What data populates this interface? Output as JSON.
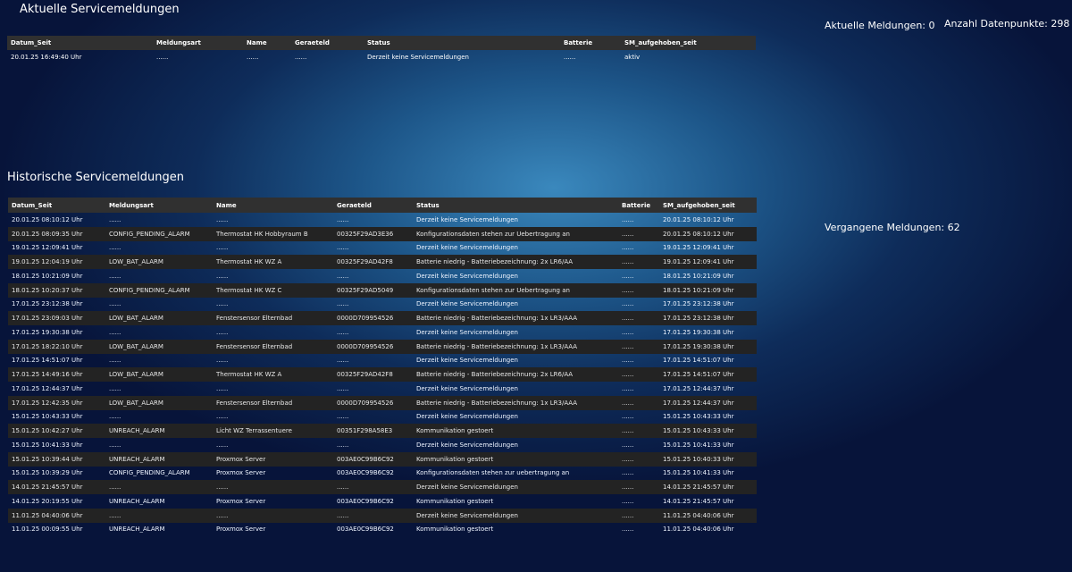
{
  "current": {
    "title": "Aktuelle Servicemeldungen",
    "columns": [
      "Datum_Seit",
      "Meldungsart",
      "Name",
      "Geraeteld",
      "Status",
      "Batterie",
      "SM_aufgehoben_seit"
    ],
    "rows": [
      [
        "20.01.25 16:49:40 Uhr",
        "......",
        "......",
        "......",
        "Derzeit keine Servicemeldungen",
        "......",
        "aktiv"
      ]
    ]
  },
  "counters": {
    "aktuelle": "Aktuelle Meldungen: 0",
    "anzahl": "Anzahl Datenpunkte: 298",
    "vergangene": "Vergangene Meldungen: 62"
  },
  "history": {
    "title": "Historische Servicemeldungen",
    "columns": [
      "Datum_Seit",
      "Meldungsart",
      "Name",
      "Geraeteld",
      "Status",
      "Batterie",
      "SM_aufgehoben_seit"
    ],
    "rows": [
      [
        "20.01.25 08:10:12 Uhr",
        "......",
        "......",
        "......",
        "Derzeit keine Servicemeldungen",
        "......",
        "20.01.25 08:10:12 Uhr"
      ],
      [
        "20.01.25 08:09:35 Uhr",
        "CONFIG_PENDING_ALARM",
        "Thermostat HK Hobbyraum B",
        "00325F29AD3E36",
        "Konfigurationsdaten stehen zur Uebertragung an",
        "......",
        "20.01.25 08:10:12 Uhr"
      ],
      [
        "19.01.25 12:09:41 Uhr",
        "......",
        "......",
        "......",
        "Derzeit keine Servicemeldungen",
        "......",
        "19.01.25 12:09:41 Uhr"
      ],
      [
        "19.01.25 12:04:19 Uhr",
        "LOW_BAT_ALARM",
        "Thermostat HK WZ A",
        "00325F29AD42F8",
        "Batterie niedrig - Batteriebezeichnung: 2x LR6/AA",
        "......",
        "19.01.25 12:09:41 Uhr"
      ],
      [
        "18.01.25 10:21:09 Uhr",
        "......",
        "......",
        "......",
        "Derzeit keine Servicemeldungen",
        "......",
        "18.01.25 10:21:09 Uhr"
      ],
      [
        "18.01.25 10:20:37 Uhr",
        "CONFIG_PENDING_ALARM",
        "Thermostat HK WZ C",
        "00325F29AD5049",
        "Konfigurationsdaten stehen zur Uebertragung an",
        "......",
        "18.01.25 10:21:09 Uhr"
      ],
      [
        "17.01.25 23:12:38 Uhr",
        "......",
        "......",
        "......",
        "Derzeit keine Servicemeldungen",
        "......",
        "17.01.25 23:12:38 Uhr"
      ],
      [
        "17.01.25 23:09:03 Uhr",
        "LOW_BAT_ALARM",
        "Fenstersensor Elternbad",
        "0000D709954526",
        "Batterie niedrig - Batteriebezeichnung: 1x LR3/AAA",
        "......",
        "17.01.25 23:12:38 Uhr"
      ],
      [
        "17.01.25 19:30:38 Uhr",
        "......",
        "......",
        "......",
        "Derzeit keine Servicemeldungen",
        "......",
        "17.01.25 19:30:38 Uhr"
      ],
      [
        "17.01.25 18:22:10 Uhr",
        "LOW_BAT_ALARM",
        "Fenstersensor Elternbad",
        "0000D709954526",
        "Batterie niedrig - Batteriebezeichnung: 1x LR3/AAA",
        "......",
        "17.01.25 19:30:38 Uhr"
      ],
      [
        "17.01.25 14:51:07 Uhr",
        "......",
        "......",
        "......",
        "Derzeit keine Servicemeldungen",
        "......",
        "17.01.25 14:51:07 Uhr"
      ],
      [
        "17.01.25 14:49:16 Uhr",
        "LOW_BAT_ALARM",
        "Thermostat HK WZ A",
        "00325F29AD42F8",
        "Batterie niedrig - Batteriebezeichnung: 2x LR6/AA",
        "......",
        "17.01.25 14:51:07 Uhr"
      ],
      [
        "17.01.25 12:44:37 Uhr",
        "......",
        "......",
        "......",
        "Derzeit keine Servicemeldungen",
        "......",
        "17.01.25 12:44:37 Uhr"
      ],
      [
        "17.01.25 12:42:35 Uhr",
        "LOW_BAT_ALARM",
        "Fenstersensor Elternbad",
        "0000D709954526",
        "Batterie niedrig - Batteriebezeichnung: 1x LR3/AAA",
        "......",
        "17.01.25 12:44:37 Uhr"
      ],
      [
        "15.01.25 10:43:33 Uhr",
        "......",
        "......",
        "......",
        "Derzeit keine Servicemeldungen",
        "......",
        "15.01.25 10:43:33 Uhr"
      ],
      [
        "15.01.25 10:42:27 Uhr",
        "UNREACH_ALARM",
        "Licht WZ Terrassentuere",
        "00351F298A58E3",
        "Kommunikation gestoert",
        "......",
        "15.01.25 10:43:33 Uhr"
      ],
      [
        "15.01.25 10:41:33 Uhr",
        "......",
        "......",
        "......",
        "Derzeit keine Servicemeldungen",
        "......",
        "15.01.25 10:41:33 Uhr"
      ],
      [
        "15.01.25 10:39:44 Uhr",
        "UNREACH_ALARM",
        "Proxmox Server",
        "003AE0C99B6C92",
        "Kommunikation gestoert",
        "......",
        "15.01.25 10:40:33 Uhr"
      ],
      [
        "15.01.25 10:39:29 Uhr",
        "CONFIG_PENDING_ALARM",
        "Proxmox Server",
        "003AE0C99B6C92",
        "Konfigurationsdaten stehen zur uebertragung an",
        "......",
        "15.01.25 10:41:33 Uhr"
      ],
      [
        "14.01.25 21:45:57 Uhr",
        "......",
        "......",
        "......",
        "Derzeit keine Servicemeldungen",
        "......",
        "14.01.25 21:45:57 Uhr"
      ],
      [
        "14.01.25 20:19:55 Uhr",
        "UNREACH_ALARM",
        "Proxmox Server",
        "003AE0C99B6C92",
        "Kommunikation gestoert",
        "......",
        "14.01.25 21:45:57 Uhr"
      ],
      [
        "11.01.25 04:40:06 Uhr",
        "......",
        "......",
        "......",
        "Derzeit keine Servicemeldungen",
        "......",
        "11.01.25 04:40:06 Uhr"
      ],
      [
        "11.01.25 00:09:55 Uhr",
        "UNREACH_ALARM",
        "Proxmox Server",
        "003AE0C99B6C92",
        "Kommunikation gestoert",
        "......",
        "11.01.25 04:40:06 Uhr"
      ]
    ]
  }
}
